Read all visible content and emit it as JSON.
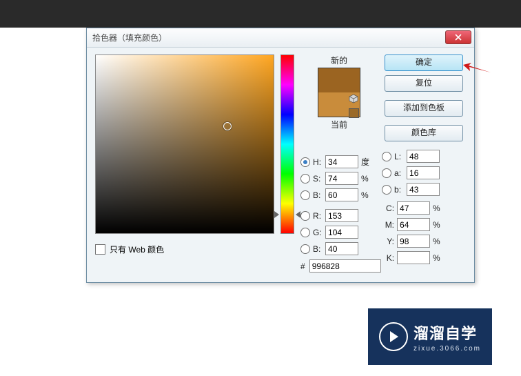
{
  "dialog": {
    "title": "拾色器（填充颜色）",
    "preview_new_label": "新的",
    "preview_current_label": "当前",
    "web_only_label": "只有 Web 颜色"
  },
  "buttons": {
    "ok": "确定",
    "reset": "复位",
    "add_swatch": "添加到色板",
    "libraries": "颜色库"
  },
  "hsb": {
    "h": {
      "label": "H:",
      "value": "34",
      "unit": "度"
    },
    "s": {
      "label": "S:",
      "value": "74",
      "unit": "%"
    },
    "b": {
      "label": "B:",
      "value": "60",
      "unit": "%"
    }
  },
  "rgb": {
    "r": {
      "label": "R:",
      "value": "153"
    },
    "g": {
      "label": "G:",
      "value": "104"
    },
    "b": {
      "label": "B:",
      "value": "40"
    }
  },
  "lab": {
    "l": {
      "label": "L:",
      "value": "48"
    },
    "a": {
      "label": "a:",
      "value": "16"
    },
    "b": {
      "label": "b:",
      "value": "43"
    }
  },
  "cmyk": {
    "c": {
      "label": "C:",
      "value": "47",
      "unit": "%"
    },
    "m": {
      "label": "M:",
      "value": "64",
      "unit": "%"
    },
    "y": {
      "label": "Y:",
      "value": "98",
      "unit": "%"
    },
    "k": {
      "label": "K:",
      "value": "",
      "unit": "%"
    }
  },
  "hex": {
    "label": "#",
    "value": "996828"
  },
  "colors": {
    "new_hex": "#9b6421",
    "current_hex": "#c98c3b",
    "hue_deg": 34
  },
  "watermark": {
    "brand": "溜溜自学",
    "url": "zixue.3066.com"
  }
}
